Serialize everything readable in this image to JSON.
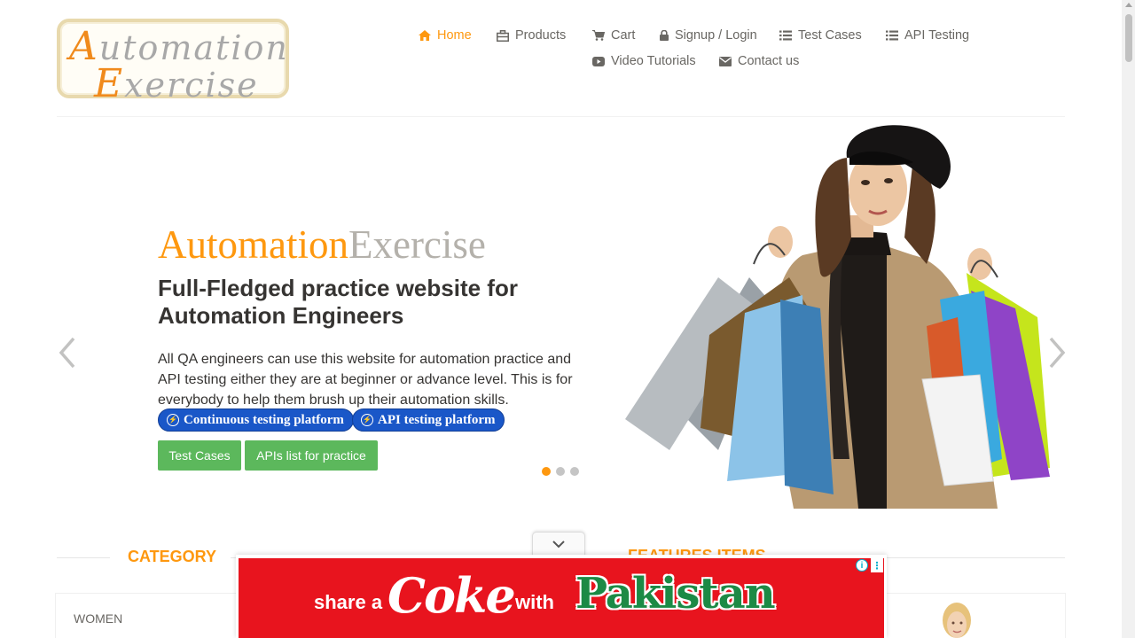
{
  "logo": {
    "line1_cap": "A",
    "line1_rest": "utomation",
    "line2_cap": "E",
    "line2_rest": "xercise"
  },
  "nav": {
    "items": [
      {
        "label": "Home",
        "icon": "home-icon",
        "active": true
      },
      {
        "label": "Products",
        "icon": "products-icon"
      },
      {
        "label": "Cart",
        "icon": "cart-icon"
      },
      {
        "label": "Signup / Login",
        "icon": "lock-icon"
      },
      {
        "label": "Test Cases",
        "icon": "list-icon"
      },
      {
        "label": "API Testing",
        "icon": "list-icon"
      },
      {
        "label": "Video Tutorials",
        "icon": "youtube-play-icon"
      },
      {
        "label": "Contact us",
        "icon": "envelope-icon"
      }
    ]
  },
  "slider": {
    "title_part1": "Automation",
    "title_part2": "Exercise",
    "heading": "Full-Fledged practice website for Automation Engineers",
    "text": "All QA engineers can use this website for automation practice and API testing either they are at beginner or advance level. This is for everybody to help them brush up their automation skills.",
    "pills": [
      "Continuous testing platform",
      "API testing platform"
    ],
    "buttons": [
      "Test Cases",
      "APIs list for practice"
    ],
    "active_slide": 1,
    "slide_count": 3
  },
  "sections": {
    "category_title": "CATEGORY",
    "features_title": "FEATURES ITEMS",
    "categories": [
      "WOMEN"
    ]
  },
  "ad": {
    "share": "share a",
    "brand": "Coke",
    "with": "with",
    "country": "Pakistan",
    "info_label": "i",
    "menu_label": "⋮"
  },
  "colors": {
    "accent": "#fe980f",
    "green": "#5cb85c",
    "pill_blue": "#1a57c8",
    "ad_red": "#e8141e"
  }
}
